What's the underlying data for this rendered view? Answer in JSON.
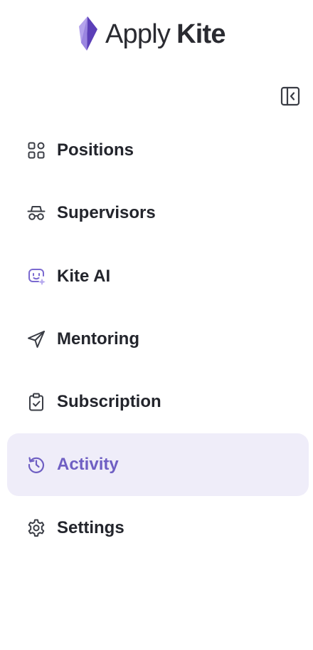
{
  "brand": {
    "name_part1": "Apply",
    "name_part2": "Kite",
    "logo_icon": "kite-logo-icon",
    "colors": {
      "purple_dark": "#5b3fb8",
      "purple_light": "#b4a3ec"
    }
  },
  "sidebar": {
    "collapse_icon": "sidebar-collapse-icon",
    "active_index": 5,
    "colors": {
      "text": "#23252c",
      "active_text": "#6f5fc3",
      "active_bg": "#efedf9",
      "icon": "#3a3d45",
      "accent": "#7b6ad0"
    },
    "items": [
      {
        "label": "Positions",
        "icon": "grid-icon"
      },
      {
        "label": "Supervisors",
        "icon": "incognito-icon"
      },
      {
        "label": "Kite AI",
        "icon": "ai-bot-icon"
      },
      {
        "label": "Mentoring",
        "icon": "send-icon"
      },
      {
        "label": "Subscription",
        "icon": "clipboard-check-icon"
      },
      {
        "label": "Activity",
        "icon": "history-icon"
      },
      {
        "label": "Settings",
        "icon": "gear-icon"
      }
    ]
  }
}
